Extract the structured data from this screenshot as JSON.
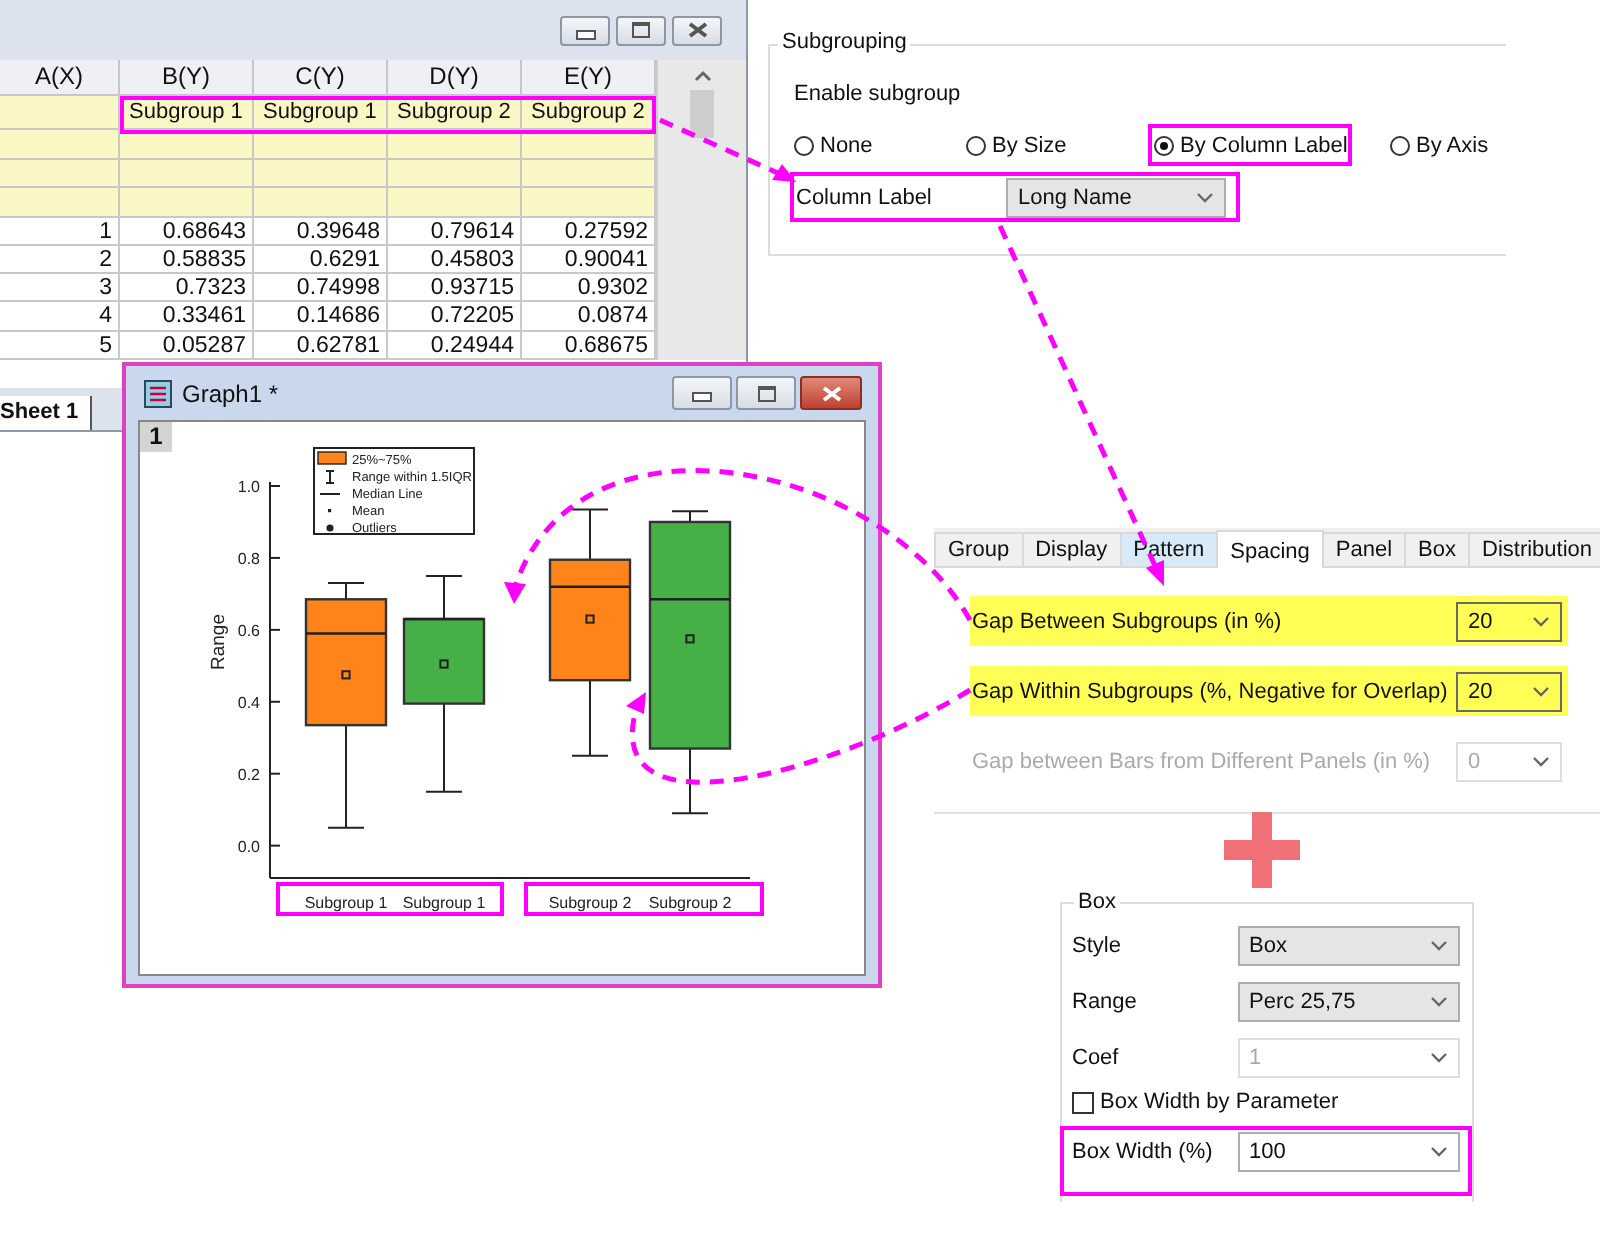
{
  "worksheet": {
    "columns": [
      "A(X)",
      "B(Y)",
      "C(Y)",
      "D(Y)",
      "E(Y)"
    ],
    "long_names": [
      "Subgroup 1",
      "Subgroup 1",
      "Subgroup 2",
      "Subgroup 2"
    ],
    "rows": [
      [
        "1",
        "0.68643",
        "0.39648",
        "0.79614",
        "0.27592"
      ],
      [
        "2",
        "0.58835",
        "0.6291",
        "0.45803",
        "0.90041"
      ],
      [
        "3",
        "0.7323",
        "0.74998",
        "0.93715",
        "0.9302"
      ],
      [
        "4",
        "0.33461",
        "0.14686",
        "0.72205",
        "0.0874"
      ],
      [
        "5",
        "0.05287",
        "0.62781",
        "0.24944",
        "0.68675"
      ]
    ],
    "sheet_tab": "Sheet 1"
  },
  "subgrouping": {
    "title": "Subgrouping",
    "enable_label": "Enable subgroup",
    "options": [
      {
        "label": "None",
        "selected": false
      },
      {
        "label": "By Size",
        "selected": false
      },
      {
        "label": "By Column Label",
        "selected": true
      },
      {
        "label": "By Axis",
        "selected": false
      }
    ],
    "column_label": {
      "label": "Column Label",
      "value": "Long Name"
    }
  },
  "graph": {
    "title": "Graph1 *",
    "layer": "1",
    "legend": [
      {
        "kind": "box",
        "label": "25%~75%"
      },
      {
        "kind": "whisker",
        "label": "Range within 1.5IQR"
      },
      {
        "kind": "line",
        "label": "Median Line"
      },
      {
        "kind": "mean",
        "label": "Mean"
      },
      {
        "kind": "outlier",
        "label": "Outliers"
      }
    ],
    "box_colors": [
      {
        "color": "#ff8419"
      },
      {
        "color": "#45b045"
      },
      {
        "color": "#ff8419"
      },
      {
        "color": "#45b045"
      }
    ],
    "chart_data": {
      "type": "box",
      "ylabel": "Range",
      "ylim": [
        -0.09,
        1.0
      ],
      "yticks": [
        {
          "value": 0,
          "label": "0.0"
        },
        {
          "value": 0.2,
          "label": "0.2"
        },
        {
          "value": 0.4,
          "label": "0.4"
        },
        {
          "value": 0.6,
          "label": "0.6"
        },
        {
          "value": 0.8,
          "label": "0.8"
        },
        {
          "value": 1,
          "label": "1.0"
        }
      ],
      "categories": [
        "Subgroup 1",
        "Subgroup 1",
        "Subgroup 2",
        "Subgroup 2"
      ]
    }
  },
  "plot_details": {
    "tabs": [
      {
        "label": "Group",
        "selected": false,
        "hovered": false
      },
      {
        "label": "Display",
        "selected": false,
        "hovered": false
      },
      {
        "label": "Pattern",
        "selected": false,
        "hovered": true
      },
      {
        "label": "Spacing",
        "selected": true,
        "hovered": false
      },
      {
        "label": "Panel",
        "selected": false,
        "hovered": false
      },
      {
        "label": "Box",
        "selected": false,
        "hovered": false
      },
      {
        "label": "Distribution",
        "selected": false,
        "hovered": false
      }
    ],
    "rows": [
      {
        "label": "Gap Between Subgroups (in %)",
        "value": "20",
        "highlighted": true,
        "disabled": false
      },
      {
        "label": "Gap Within Subgroups (%, Negative for Overlap)",
        "value": "20",
        "highlighted": true,
        "disabled": false
      },
      {
        "label": "Gap between Bars from Different Panels (in %)",
        "value": "0",
        "highlighted": false,
        "disabled": true
      }
    ]
  },
  "box": {
    "title": "Box",
    "fields": [
      {
        "kind": "select",
        "label": "Style",
        "value": "Box",
        "disabled": false
      },
      {
        "kind": "select",
        "label": "Range",
        "value": "Perc 25,75",
        "disabled": false
      },
      {
        "kind": "select",
        "label": "Coef",
        "value": "1",
        "disabled": true
      },
      {
        "kind": "checkbox",
        "label": "Box Width by Parameter",
        "checked": false
      },
      {
        "kind": "input",
        "label": "Box Width (%)",
        "value": "100",
        "disabled": false
      }
    ]
  }
}
